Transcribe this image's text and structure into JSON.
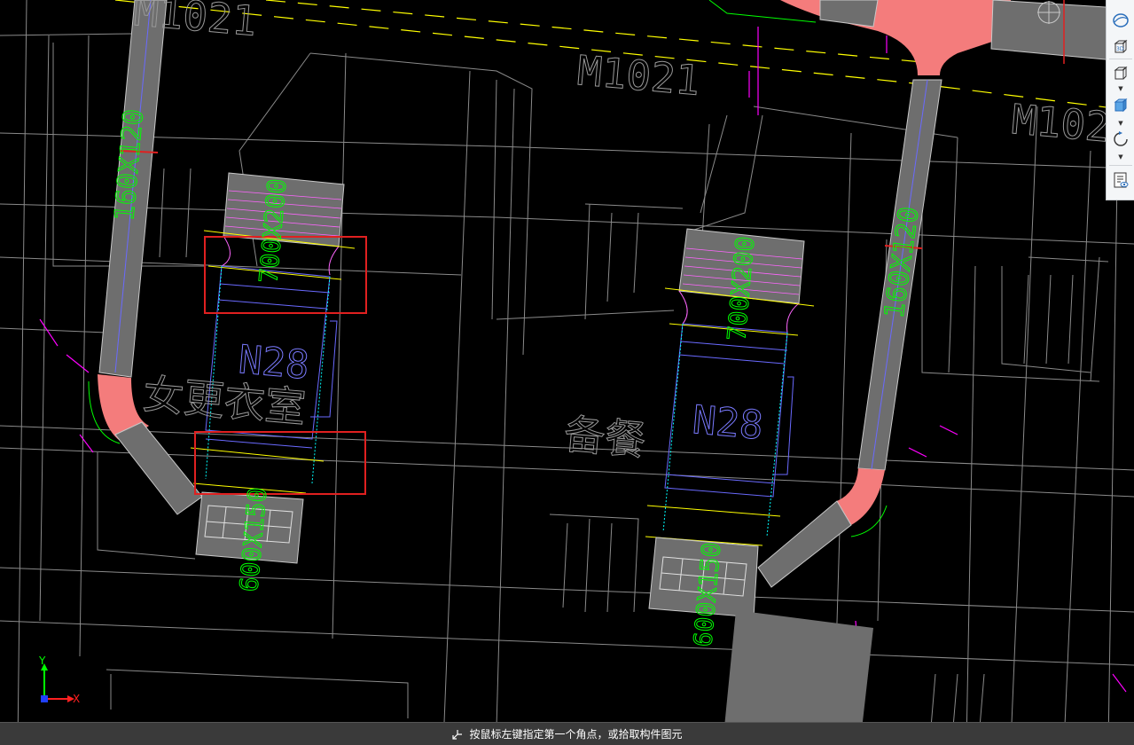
{
  "drawing": {
    "room_labels": {
      "left_room": "女更衣室",
      "right_room": "备餐"
    },
    "door_labels": {
      "door_top_center": "M1021",
      "door_top_left": "M1021",
      "door_top_right": "M102"
    },
    "equipment_labels": {
      "left_unit": "N28",
      "right_unit": "N28"
    },
    "duct_labels": {
      "left_vertical_duct": "160X120",
      "right_vertical_duct": "160X120",
      "left_top_box": "700X200",
      "right_top_box": "700X200",
      "left_bottom_box": "600X150",
      "right_bottom_box": "600X150"
    }
  },
  "toolbar": {
    "items": [
      {
        "name": "view-sphere-icon"
      },
      {
        "name": "view-3d-icon",
        "label": "3D"
      },
      {
        "name": "box-view-icon"
      },
      {
        "name": "box-solid-icon"
      },
      {
        "name": "rotate-icon"
      },
      {
        "name": "properties-panel-icon"
      }
    ]
  },
  "axis": {
    "x_label": "X",
    "y_label": "Y"
  },
  "statusbar": {
    "message": "按鼠标左键指定第一个角点，或拾取构件图元"
  },
  "colors": {
    "background": "#000000",
    "duct_fill": "#6e6e6e",
    "duct_highlight": "#f47c7c",
    "dim_text": "#00ff00",
    "grid_line": "#8a8a8a",
    "selection_box": "#e02020",
    "yellow_line": "#ffff00",
    "blue_line": "#6a6aff",
    "magenta_line": "#ff00ff"
  }
}
